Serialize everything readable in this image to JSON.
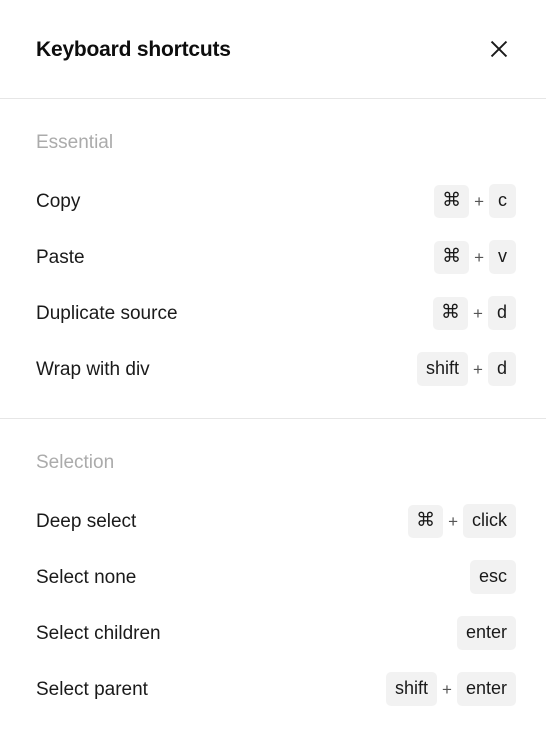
{
  "dialog": {
    "title": "Keyboard shortcuts",
    "close_icon": "close-icon"
  },
  "colors": {
    "background": "#ffffff",
    "text": "#1a1a1a",
    "title": "#0d0d0d",
    "section_heading": "#ababab",
    "key_background": "#f2f2f2",
    "divider": "#e6e6e6",
    "plus": "#555555"
  },
  "sections": [
    {
      "heading": "Essential",
      "rows": [
        {
          "label": "Copy",
          "keys": [
            "⌘",
            "c"
          ],
          "separator": "+"
        },
        {
          "label": "Paste",
          "keys": [
            "⌘",
            "v"
          ],
          "separator": "+"
        },
        {
          "label": "Duplicate source",
          "keys": [
            "⌘",
            "d"
          ],
          "separator": "+"
        },
        {
          "label": "Wrap with div",
          "keys": [
            "shift",
            "d"
          ],
          "separator": "+"
        }
      ]
    },
    {
      "heading": "Selection",
      "rows": [
        {
          "label": "Deep select",
          "keys": [
            "⌘",
            "click"
          ],
          "separator": "+"
        },
        {
          "label": "Select none",
          "keys": [
            "esc"
          ],
          "separator": "+"
        },
        {
          "label": "Select children",
          "keys": [
            "enter"
          ],
          "separator": "+"
        },
        {
          "label": "Select parent",
          "keys": [
            "shift",
            "enter"
          ],
          "separator": "+"
        }
      ]
    }
  ]
}
